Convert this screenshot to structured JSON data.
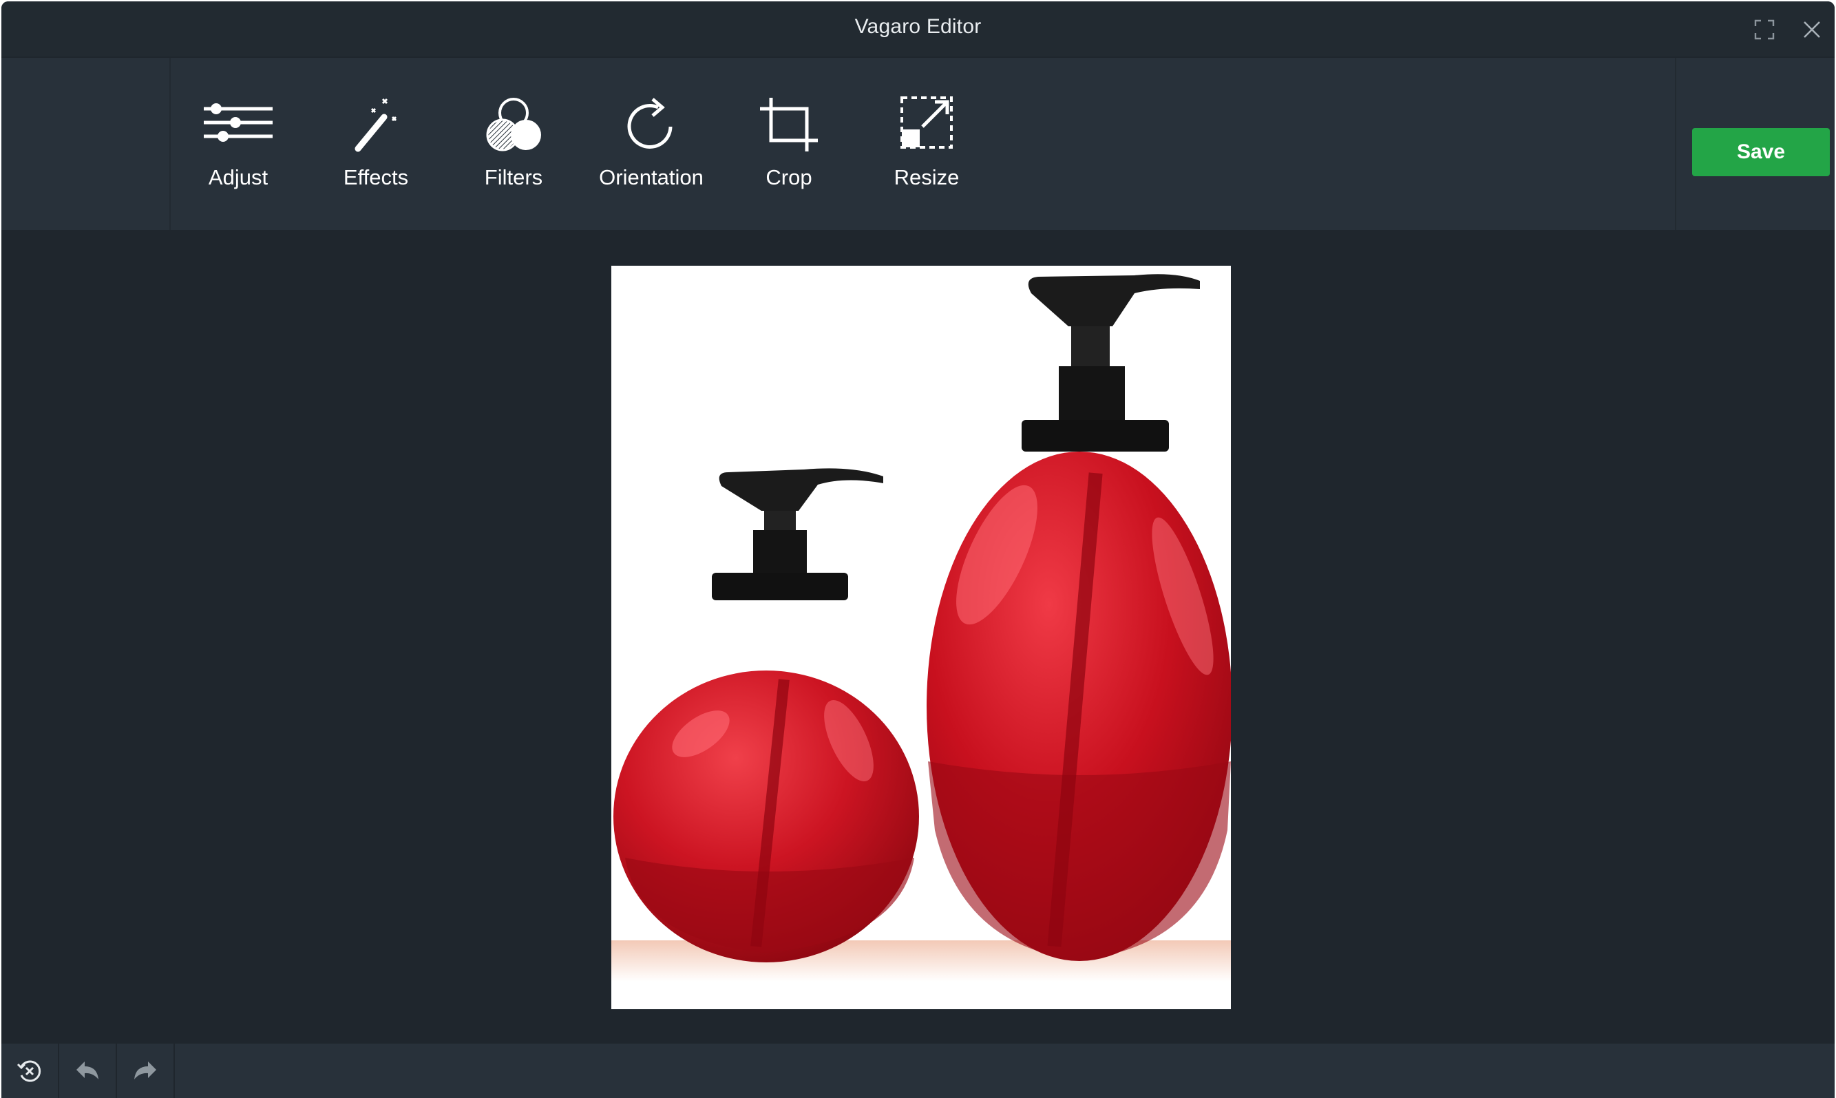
{
  "window": {
    "title": "Vagaro Editor"
  },
  "toolbar": {
    "tools": [
      {
        "label": "Adjust",
        "icon": "sliders-icon"
      },
      {
        "label": "Effects",
        "icon": "magic-wand-icon"
      },
      {
        "label": "Filters",
        "icon": "filter-circles-icon"
      },
      {
        "label": "Orientation",
        "icon": "rotate-icon"
      },
      {
        "label": "Crop",
        "icon": "crop-icon"
      },
      {
        "label": "Resize",
        "icon": "resize-icon"
      }
    ],
    "save_label": "Save"
  },
  "colors": {
    "accent": "#23a547",
    "background": "#1f262d",
    "toolbar": "#28313a",
    "titlebar": "#222a31"
  },
  "canvas": {
    "image": "two red pump bottles"
  },
  "bottombar": {
    "buttons": [
      {
        "icon": "reset-icon"
      },
      {
        "icon": "undo-icon"
      },
      {
        "icon": "redo-icon"
      }
    ]
  }
}
